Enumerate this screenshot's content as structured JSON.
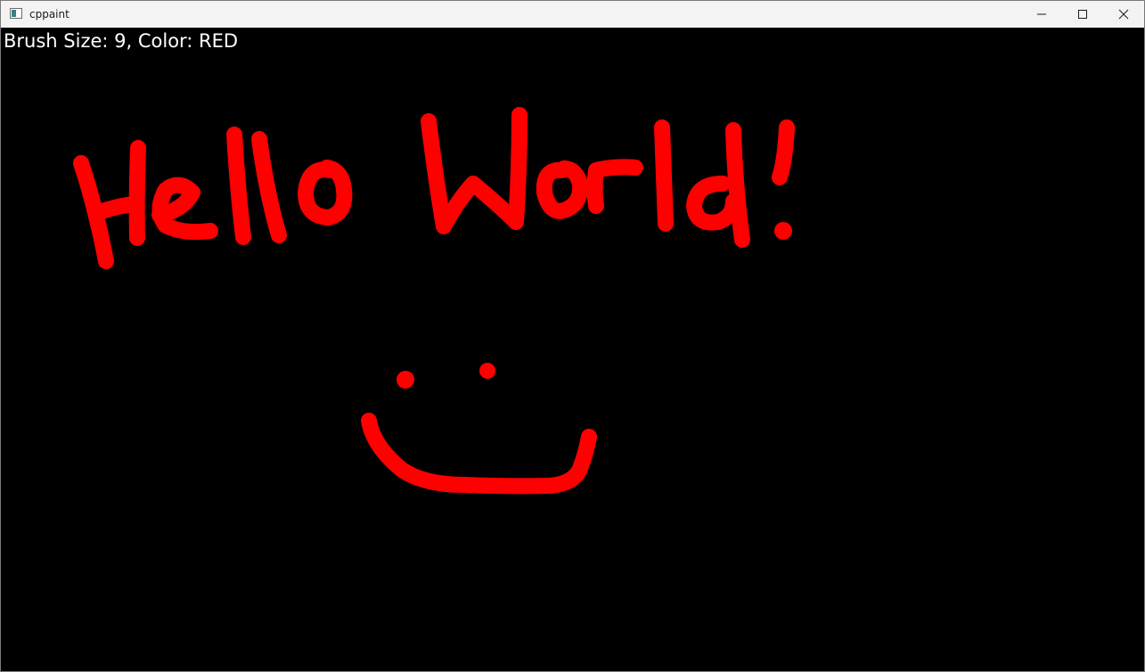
{
  "window": {
    "title": "cppaint",
    "icon": "app-window-icon"
  },
  "controls": {
    "minimize_icon": "minimize-icon",
    "maximize_icon": "maximize-icon",
    "close_icon": "close-icon"
  },
  "canvas": {
    "background": "#000000",
    "status": "Brush Size: 9, Color: RED",
    "brush_color": "#ff0000",
    "handwriting": "Hello World!"
  }
}
